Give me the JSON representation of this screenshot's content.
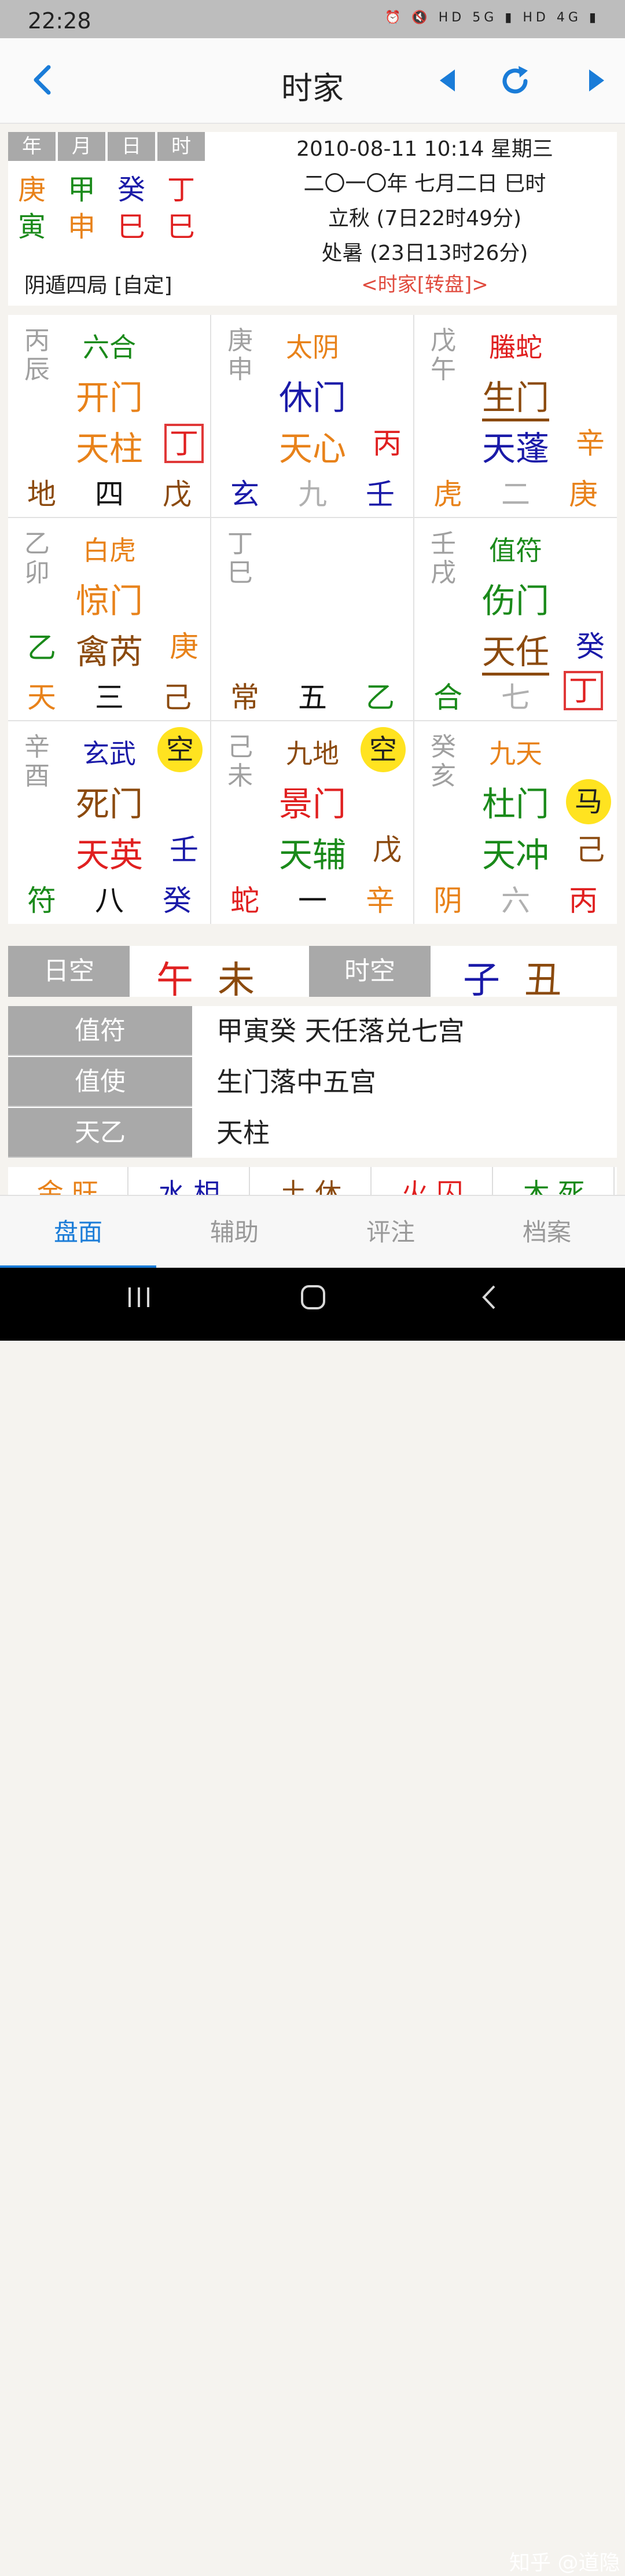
{
  "status": {
    "time": "22:28",
    "icons_text": "⏰ 🔇 HD 5G ▮ HD 4G ▮"
  },
  "app": {
    "title": "时家"
  },
  "pillars": {
    "headers": [
      "年",
      "月",
      "日",
      "时"
    ],
    "stems": [
      {
        "char": "庚",
        "color": "#e8821a"
      },
      {
        "char": "甲",
        "color": "#1a8a1a"
      },
      {
        "char": "癸",
        "color": "#1a1aa8"
      },
      {
        "char": "丁",
        "color": "#e02020"
      }
    ],
    "branches": [
      {
        "char": "寅",
        "color": "#1a8a1a"
      },
      {
        "char": "申",
        "color": "#e8821a"
      },
      {
        "char": "巳",
        "color": "#e02020"
      },
      {
        "char": "巳",
        "color": "#e02020"
      }
    ]
  },
  "info": {
    "datetime": "2010-08-11 10:14 星期三",
    "lunar": "二〇一〇年 七月二日 巳时",
    "term1": "立秋 (7日22时49分)",
    "term2": "处暑 (23日13时26分)",
    "ju": "阴遁四局 [自定]",
    "mode": "<时家[转盘]>"
  },
  "palaces": [
    {
      "stem": "丙辰",
      "deity": "六合",
      "deity_color": "#1a8a1a",
      "door": "开门",
      "door_color": "#e8821a",
      "star": "天柱",
      "star_color": "#e8821a",
      "star_underline": false,
      "side": "丁",
      "side_color": "#e02020",
      "side_box": true,
      "bl": "地",
      "bl_color": "#8b4a0e",
      "bm": "四",
      "bm_color": "#111",
      "br": "戊",
      "br_color": "#8b4a0e"
    },
    {
      "stem": "庚申",
      "deity": "太阴",
      "deity_color": "#e8821a",
      "door": "休门",
      "door_color": "#1a1aa8",
      "star": "天心",
      "star_color": "#e8821a",
      "star_underline": false,
      "side": "丙",
      "side_color": "#e02020",
      "side_box": false,
      "bl": "玄",
      "bl_color": "#1a1aa8",
      "bm": "九",
      "bm_color": "#b0b0b0",
      "br": "壬",
      "br_color": "#1a1aa8"
    },
    {
      "stem": "戊午",
      "deity": "螣蛇",
      "deity_color": "#e02020",
      "door": "生门",
      "door_color": "#8b4a0e",
      "door_underline": true,
      "star": "天蓬",
      "star_color": "#1a1aa8",
      "star_underline": false,
      "side": "辛",
      "side_color": "#e8821a",
      "side_box": false,
      "bl": "虎",
      "bl_color": "#e8821a",
      "bm": "二",
      "bm_color": "#b0b0b0",
      "br": "庚",
      "br_color": "#e8821a"
    },
    {
      "stem": "乙卯",
      "deity": "白虎",
      "deity_color": "#e8821a",
      "door": "惊门",
      "door_color": "#e8821a",
      "star": "禽芮",
      "star_color": "#8b4a0e",
      "star_underline": false,
      "side": "庚",
      "side_color": "#e8821a",
      "side_box": false,
      "bl": "天",
      "bl_color": "#e8821a",
      "bm": "三",
      "bm_color": "#111",
      "br": "己",
      "br_color": "#8b4a0e",
      "bl2": "乙",
      "bl2_color": "#1a8a1a"
    },
    {
      "stem": "丁巳",
      "deity": "",
      "deity_color": "#111",
      "door": "",
      "door_color": "#111",
      "star": "",
      "star_color": "#111",
      "star_underline": false,
      "side": "",
      "side_color": "#111",
      "side_box": false,
      "bl": "常",
      "bl_color": "#8b4a0e",
      "bm": "五",
      "bm_color": "#111",
      "br": "乙",
      "br_color": "#1a8a1a"
    },
    {
      "stem": "壬戌",
      "deity": "值符",
      "deity_color": "#1a8a1a",
      "door": "伤门",
      "door_color": "#1a8a1a",
      "star": "天任",
      "star_color": "#8b4a0e",
      "star_underline": true,
      "side": "癸",
      "side_color": "#1a1aa8",
      "side_box": false,
      "bl": "合",
      "bl_color": "#1a8a1a",
      "bm": "七",
      "bm_color": "#b0b0b0",
      "br": "丁",
      "br_color": "#e02020",
      "br_box": true
    },
    {
      "stem": "辛酉",
      "deity": "玄武",
      "deity_color": "#1a1aa8",
      "door": "死门",
      "door_color": "#8b4a0e",
      "star": "天英",
      "star_color": "#e02020",
      "star_underline": false,
      "side": "壬",
      "side_color": "#1a1aa8",
      "side_box": false,
      "bl": "符",
      "bl_color": "#1a8a1a",
      "bm": "八",
      "bm_color": "#111",
      "br": "癸",
      "br_color": "#1a1aa8",
      "badge": "空"
    },
    {
      "stem": "己未",
      "deity": "九地",
      "deity_color": "#8b4a0e",
      "door": "景门",
      "door_color": "#e02020",
      "star": "天辅",
      "star_color": "#1a8a1a",
      "star_underline": false,
      "side": "戊",
      "side_color": "#8b4a0e",
      "side_box": false,
      "bl": "蛇",
      "bl_color": "#e02020",
      "bm": "一",
      "bm_color": "#111",
      "br": "辛",
      "br_color": "#e8821a",
      "badge": "空"
    },
    {
      "stem": "癸亥",
      "deity": "九天",
      "deity_color": "#e8821a",
      "door": "杜门",
      "door_color": "#1a8a1a",
      "star": "天冲",
      "star_color": "#1a8a1a",
      "star_underline": false,
      "side": "己",
      "side_color": "#8b4a0e",
      "side_box": false,
      "bl": "阴",
      "bl_color": "#e8821a",
      "bm": "六",
      "bm_color": "#b0b0b0",
      "br": "丙",
      "br_color": "#e02020",
      "horse": "马"
    }
  ],
  "kong": {
    "day_label": "日空",
    "day_a": "午",
    "day_a_color": "#e02020",
    "day_b": "未",
    "day_b_color": "#8b4a0e",
    "hour_label": "时空",
    "hour_a": "子",
    "hour_a_color": "#1a1aa8",
    "hour_b": "丑",
    "hour_b_color": "#8b4a0e"
  },
  "duty": [
    {
      "label": "值符",
      "value": "甲寅癸  天任落兑七宫"
    },
    {
      "label": "值使",
      "value": "生门落中五宫"
    },
    {
      "label": "天乙",
      "value": "天柱"
    }
  ],
  "elements": [
    {
      "text": "金 旺",
      "color": "#e8821a"
    },
    {
      "text": "水 相",
      "color": "#1a1aa8"
    },
    {
      "text": "土 休",
      "color": "#8b4a0e"
    },
    {
      "text": "火 囚",
      "color": "#e02020"
    },
    {
      "text": "木 死",
      "color": "#1a8a1a"
    }
  ],
  "tabs": [
    "盘面",
    "辅助",
    "评注",
    "档案"
  ],
  "watermark": "知乎 @道隐"
}
